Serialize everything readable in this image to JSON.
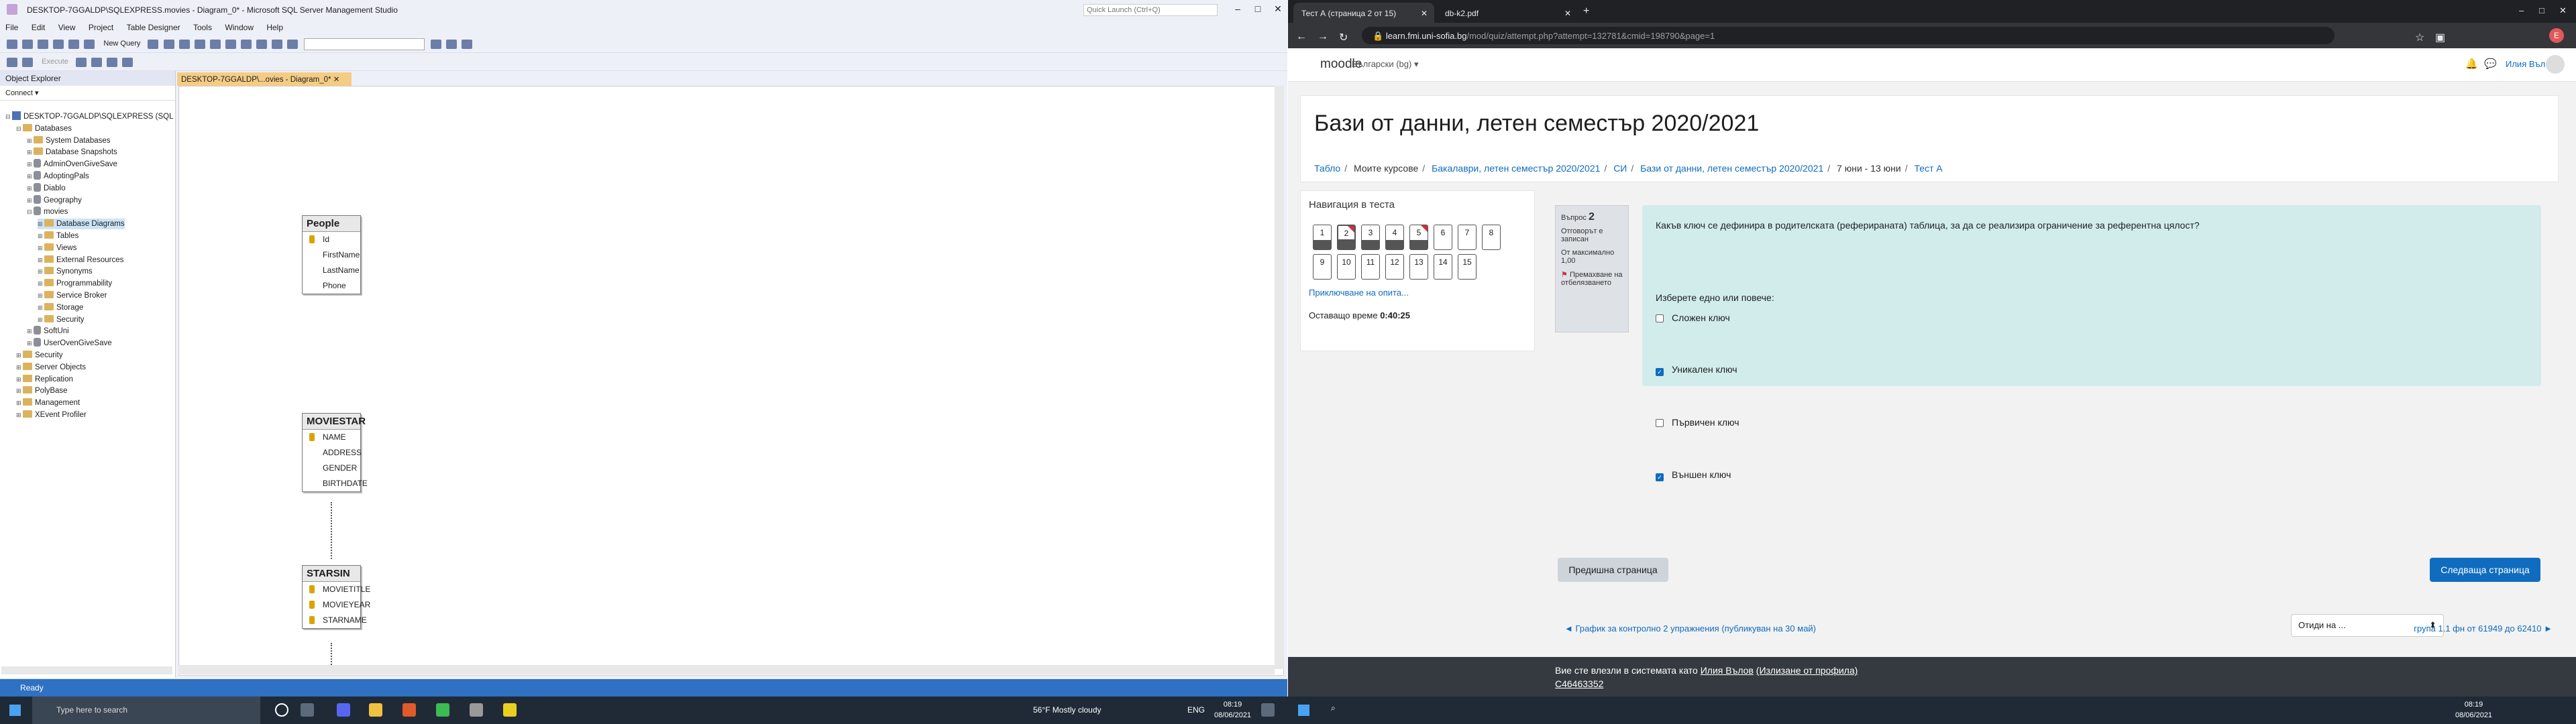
{
  "ssms": {
    "title": "DESKTOP-7GGALDP\\SQLEXPRESS.movies - Diagram_0* - Microsoft SQL Server Management Studio",
    "quick_launch": "Quick Launch (Ctrl+Q)",
    "menu": [
      "File",
      "Edit",
      "View",
      "Project",
      "Table Designer",
      "Tools",
      "Window",
      "Help"
    ],
    "new_query": "New Query",
    "execute": "Execute",
    "object_explorer": {
      "title": "Object Explorer",
      "connect": "Connect ▾",
      "tree": [
        {
          "label": "DESKTOP-7GGALDP\\SQLEXPRESS (SQL",
          "indent": 0,
          "exp": "⊟",
          "icon": "server"
        },
        {
          "label": "Databases",
          "indent": 1,
          "exp": "⊟",
          "icon": "folder"
        },
        {
          "label": "System Databases",
          "indent": 2,
          "exp": "⊞",
          "icon": "folder"
        },
        {
          "label": "Database Snapshots",
          "indent": 2,
          "exp": "⊞",
          "icon": "folder"
        },
        {
          "label": "AdminOvenGiveSave",
          "indent": 2,
          "exp": "⊞",
          "icon": "db"
        },
        {
          "label": "AdoptingPals",
          "indent": 2,
          "exp": "⊞",
          "icon": "db"
        },
        {
          "label": "Diablo",
          "indent": 2,
          "exp": "⊞",
          "icon": "db"
        },
        {
          "label": "Geography",
          "indent": 2,
          "exp": "⊞",
          "icon": "db"
        },
        {
          "label": "movies",
          "indent": 2,
          "exp": "⊟",
          "icon": "db"
        },
        {
          "label": "Database Diagrams",
          "indent": 3,
          "exp": "⊞",
          "icon": "folder",
          "selected": true
        },
        {
          "label": "Tables",
          "indent": 3,
          "exp": "⊞",
          "icon": "folder"
        },
        {
          "label": "Views",
          "indent": 3,
          "exp": "⊞",
          "icon": "folder"
        },
        {
          "label": "External Resources",
          "indent": 3,
          "exp": "⊞",
          "icon": "folder"
        },
        {
          "label": "Synonyms",
          "indent": 3,
          "exp": "⊞",
          "icon": "folder"
        },
        {
          "label": "Programmability",
          "indent": 3,
          "exp": "⊞",
          "icon": "folder"
        },
        {
          "label": "Service Broker",
          "indent": 3,
          "exp": "⊞",
          "icon": "folder"
        },
        {
          "label": "Storage",
          "indent": 3,
          "exp": "⊞",
          "icon": "folder"
        },
        {
          "label": "Security",
          "indent": 3,
          "exp": "⊞",
          "icon": "folder"
        },
        {
          "label": "SoftUni",
          "indent": 2,
          "exp": "⊞",
          "icon": "db"
        },
        {
          "label": "UserOvenGiveSave",
          "indent": 2,
          "exp": "⊞",
          "icon": "db"
        },
        {
          "label": "Security",
          "indent": 1,
          "exp": "⊞",
          "icon": "folder"
        },
        {
          "label": "Server Objects",
          "indent": 1,
          "exp": "⊞",
          "icon": "folder"
        },
        {
          "label": "Replication",
          "indent": 1,
          "exp": "⊞",
          "icon": "folder"
        },
        {
          "label": "PolyBase",
          "indent": 1,
          "exp": "⊞",
          "icon": "folder"
        },
        {
          "label": "Management",
          "indent": 1,
          "exp": "⊞",
          "icon": "folder"
        },
        {
          "label": "XEvent Profiler",
          "indent": 1,
          "exp": "⊞",
          "icon": "folder"
        }
      ]
    },
    "doc_tab": "DESKTOP-7GGALDP\\...ovies - Diagram_0*",
    "tables": [
      {
        "name": "People",
        "columns": [
          {
            "n": "Id",
            "key": true
          },
          {
            "n": "FirstName"
          },
          {
            "n": "LastName"
          },
          {
            "n": "Phone"
          }
        ]
      },
      {
        "name": "MOVIESTAR",
        "columns": [
          {
            "n": "NAME",
            "key": true
          },
          {
            "n": "ADDRESS"
          },
          {
            "n": "GENDER"
          },
          {
            "n": "BIRTHDATE"
          }
        ]
      },
      {
        "name": "STARSIN",
        "columns": [
          {
            "n": "MOVIETITLE",
            "key": true
          },
          {
            "n": "MOVIEYEAR",
            "key": true
          },
          {
            "n": "STARNAME",
            "key": true
          }
        ]
      }
    ],
    "status": "Ready"
  },
  "browser": {
    "tabs": [
      {
        "label": "Тест А (страница 2 от 15)",
        "active": true
      },
      {
        "label": "db-k2.pdf",
        "active": false
      }
    ],
    "url_host": "learn.fmi.uni-sofia.bg",
    "url_path": "/mod/quiz/attempt.php?attempt=132781&cmid=198790&page=1",
    "moodle": {
      "brand": "moodle",
      "language": "Български (bg) ▾",
      "user": "Илия Вълов",
      "course_title": "Бази от данни, летен семестър 2020/2021",
      "breadcrumbs": [
        {
          "t": "Табло",
          "link": true
        },
        {
          "t": "Моите курсове",
          "link": false
        },
        {
          "t": "Бакалаври, летен семестър 2020/2021",
          "link": true
        },
        {
          "t": "СИ",
          "link": true
        },
        {
          "t": "Бази от данни, летен семестър 2020/2021",
          "link": true
        },
        {
          "t": "7 юни - 13 юни",
          "link": false
        },
        {
          "t": "Тест А",
          "link": true
        }
      ],
      "nav_title": "Навигация в теста",
      "questions": [
        {
          "n": "1",
          "ans": true
        },
        {
          "n": "2",
          "ans": true,
          "flag": true,
          "cur": true
        },
        {
          "n": "3",
          "ans": true
        },
        {
          "n": "4",
          "ans": true
        },
        {
          "n": "5",
          "ans": true,
          "flag": true
        },
        {
          "n": "6"
        },
        {
          "n": "7"
        },
        {
          "n": "8"
        },
        {
          "n": "9"
        },
        {
          "n": "10"
        },
        {
          "n": "11"
        },
        {
          "n": "12"
        },
        {
          "n": "13"
        },
        {
          "n": "14"
        },
        {
          "n": "15"
        }
      ],
      "finish_link": "Приключване на опита...",
      "time_label": "Оставащо време",
      "time_value": "0:40:25",
      "qinfo": {
        "label": "Въпрос",
        "num": "2",
        "status": "Отговорът е записан",
        "marks": "От максимално 1,00",
        "flag": "Премахване на отбелязването"
      },
      "question": "Какъв ключ се дефинира в родителската (реферираната) таблица, за да се реализира ограничение за референтна цялост?",
      "prompt": "Изберете едно или повече:",
      "options": [
        {
          "t": "Сложен ключ",
          "checked": false
        },
        {
          "t": "Уникален ключ",
          "checked": true
        },
        {
          "t": "Първичен ключ",
          "checked": false
        },
        {
          "t": "Външен ключ",
          "checked": true
        }
      ],
      "prev_btn": "Предишна страница",
      "next_btn": "Следваща страница",
      "bottom_prev": "◄ График за контролно 2 упражнения (публикуван на 30 май)",
      "jump": "Отиди на ...",
      "bottom_next": "група 1.1 фн от 61949 до 62410 ►",
      "footer_text": "Вие сте влезли в системата като",
      "footer_user": "Илия Вълов",
      "footer_logout": "(Излизане от профила)",
      "footer_code": "C46463352"
    }
  },
  "taskbar": {
    "search": "Type here to search",
    "weather": "56°F  Mostly cloudy",
    "lang": "ENG",
    "time": "08:19",
    "date": "08/06/2021"
  }
}
